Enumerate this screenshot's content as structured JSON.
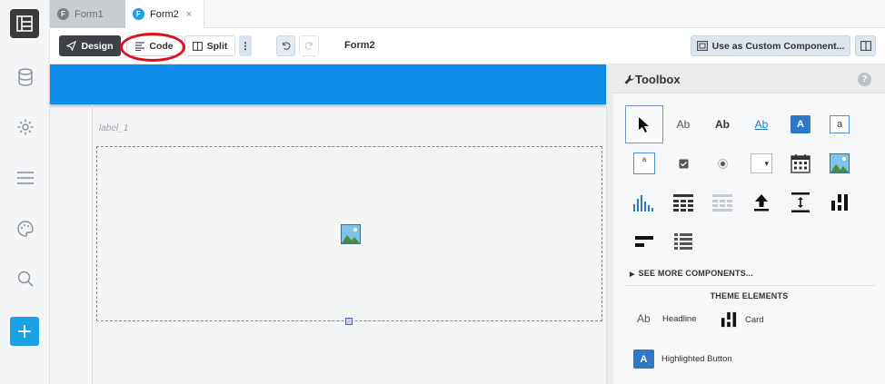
{
  "tabs": [
    {
      "label": "Form1",
      "active": false
    },
    {
      "label": "Form2",
      "active": true
    }
  ],
  "tab_close": "×",
  "toolbar": {
    "design_label": "Design",
    "code_label": "Code",
    "split_label": "Split",
    "more_label": "⋮",
    "form_name": "Form2",
    "custom_component_label": "Use as Custom Component..."
  },
  "canvas": {
    "label_text": "label_1",
    "header_color": "#0d8ce8"
  },
  "toolbox": {
    "title": "Toolbox",
    "help": "?",
    "components": [
      {
        "name": "pointer-tool",
        "glyph": ""
      },
      {
        "name": "label-tool",
        "glyph": "Ab"
      },
      {
        "name": "bold-label-tool",
        "glyph": "Ab"
      },
      {
        "name": "link-tool",
        "glyph": "Ab"
      },
      {
        "name": "button-tool",
        "glyph": "A"
      },
      {
        "name": "textbox-tool",
        "glyph": "a"
      },
      {
        "name": "textarea-tool",
        "glyph": "a"
      },
      {
        "name": "checkbox-tool",
        "glyph": ""
      },
      {
        "name": "radio-tool",
        "glyph": ""
      },
      {
        "name": "dropdown-tool",
        "glyph": "▾"
      },
      {
        "name": "datepicker-tool",
        "glyph": ""
      },
      {
        "name": "image-tool",
        "glyph": ""
      },
      {
        "name": "plot-tool",
        "glyph": ""
      },
      {
        "name": "data-grid-tool",
        "glyph": ""
      },
      {
        "name": "repeating-panel-tool",
        "glyph": ""
      },
      {
        "name": "file-loader-tool",
        "glyph": ""
      },
      {
        "name": "spacer-tool",
        "glyph": ""
      },
      {
        "name": "column-panel-tool",
        "glyph": ""
      },
      {
        "name": "flow-panel-tool",
        "glyph": ""
      },
      {
        "name": "linear-panel-tool",
        "glyph": ""
      }
    ],
    "see_more_label": "SEE MORE COMPONENTS...",
    "theme_title": "THEME ELEMENTS",
    "theme_items": [
      {
        "label": "Headline",
        "glyph": "Ab"
      },
      {
        "label": "Card",
        "glyph": ""
      },
      {
        "label": "Highlighted Button",
        "glyph": "A"
      }
    ]
  },
  "colors": {
    "accent": "#1aa1e6",
    "dark_button": "#3e4247",
    "highlight_circle": "#d9121c"
  }
}
